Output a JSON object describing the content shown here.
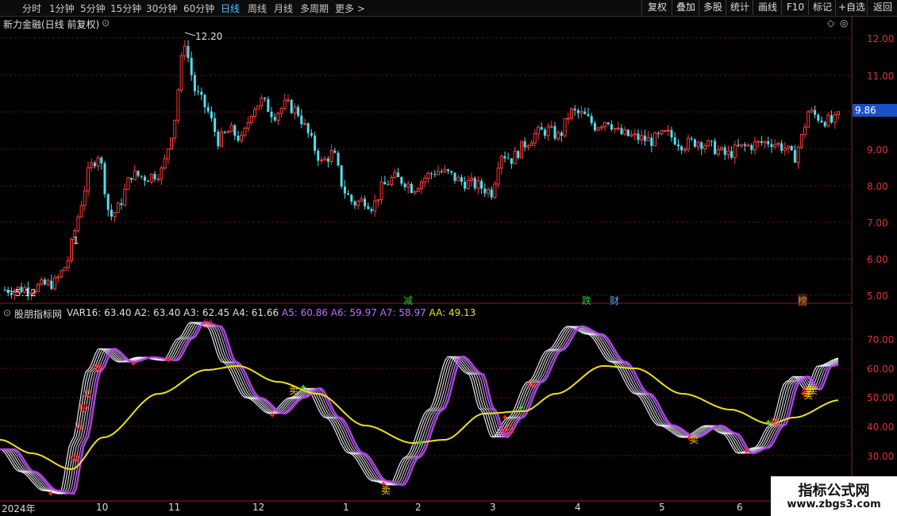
{
  "toolbar": {
    "periods": [
      "分时",
      "1分钟",
      "5分钟",
      "15分钟",
      "30分钟",
      "60分钟",
      "日线",
      "周线",
      "月线",
      "多周期",
      "更多"
    ],
    "active_period": "日线",
    "more_arrow": ">",
    "right_buttons": [
      "复权",
      "叠加",
      "多股",
      "统计",
      "画线",
      "F10",
      "标记",
      "+自选",
      "返回"
    ]
  },
  "main_title": "新力金融(日线 前复权)",
  "price_labels": [
    "12.00",
    "11.00",
    "10.00",
    "9.00",
    "8.00",
    "7.00",
    "6.00",
    "5.00"
  ],
  "current_price": "9.86",
  "high_marker": "12.20",
  "low_marker": "5.12",
  "one_marker": "1",
  "event_tags": [
    {
      "text": "减",
      "color": "#28c828"
    },
    {
      "text": "跌",
      "color": "#28c828"
    },
    {
      "text": "财",
      "color": "#4aa8ff"
    },
    {
      "text": "榜",
      "color": "#e08030"
    }
  ],
  "indicator": {
    "name": "股朋指标网",
    "values": [
      {
        "label": "VAR16: 63.40",
        "color": "#e0e0e0"
      },
      {
        "label": "A2: 63.40",
        "color": "#e0e0e0"
      },
      {
        "label": "A3: 62.45",
        "color": "#e0e0e0"
      },
      {
        "label": "A4: 61.66",
        "color": "#e0e0e0"
      },
      {
        "label": "A5: 60.86",
        "color": "#c070ff"
      },
      {
        "label": "A6: 59.97",
        "color": "#c070ff"
      },
      {
        "label": "A7: 58.97",
        "color": "#c070ff"
      },
      {
        "label": "AA: 49.13",
        "color": "#f0e020"
      }
    ],
    "axis_labels": [
      "70.00",
      "60.00",
      "50.00",
      "40.00",
      "30.00"
    ]
  },
  "sub_tags": [
    "做",
    "吸",
    "吸",
    "吸",
    "吸",
    "抛",
    "卖",
    "卖",
    "位",
    "位",
    "做",
    "吸",
    "卖",
    "卖",
    "吸",
    "卖",
    "卖"
  ],
  "date_axis": [
    "2024年",
    "10",
    "11",
    "12",
    "1",
    "2",
    "3",
    "4",
    "5",
    "6"
  ],
  "watermark": {
    "title": "指标公式网",
    "url": "www.zbgs3.com"
  }
}
